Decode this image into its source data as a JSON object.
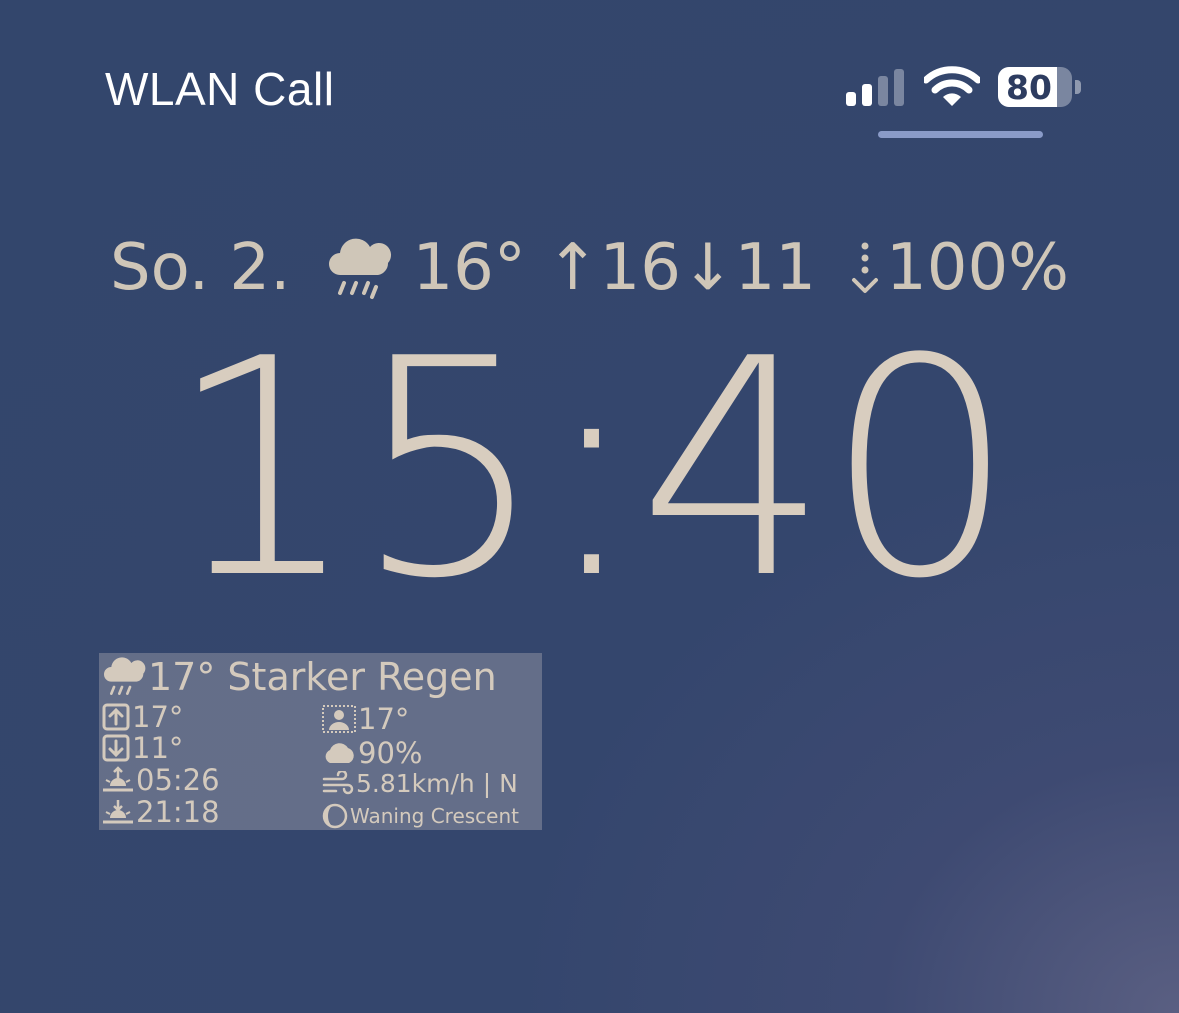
{
  "status_bar": {
    "carrier": "WLAN Call",
    "signal_bars_active": 2,
    "signal_bars_total": 4,
    "battery_percent": 80,
    "battery_label": "80"
  },
  "weather_line": {
    "date": "So. 2.",
    "icon": "rain-cloud-icon",
    "temp": "16°",
    "high": "↑16",
    "low": "↓11",
    "precip_icon": "precipitation-arrow-icon",
    "precip": "100%"
  },
  "clock": {
    "time": "15:40"
  },
  "widget": {
    "title": "17° Starker Regen",
    "high": "17°",
    "low": "11°",
    "sunrise": "05:26",
    "sunset": "21:18",
    "feels_like": "17°",
    "cloud_cover": "90%",
    "wind": "5.81km/h | N",
    "moon_phase": "Waning Crescent"
  },
  "colors": {
    "background": "#33466c",
    "text": "#cfc6b8",
    "status_text": "#ffffff"
  }
}
